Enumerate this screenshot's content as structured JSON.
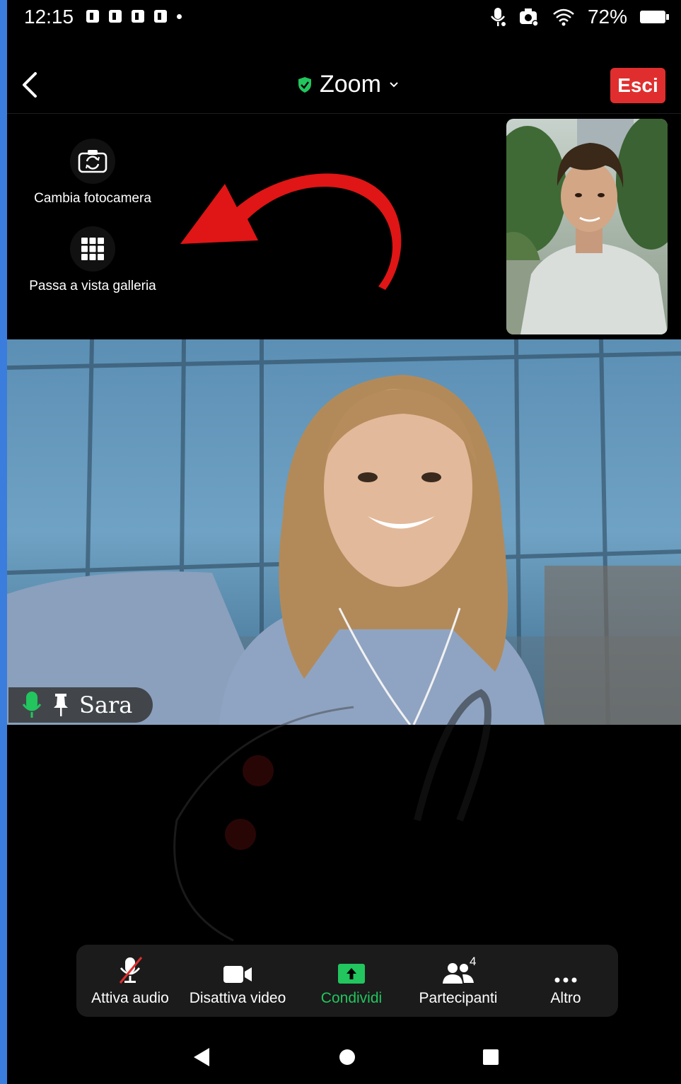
{
  "status_bar": {
    "time": "12:15",
    "battery": "72%",
    "icons": [
      "gallery-notification-icon",
      "facebook-notification-icon",
      "facebook-notification-icon",
      "facebook-notification-icon",
      "dot-icon",
      "mic-in-use-icon",
      "camera-in-use-icon",
      "wifi-icon",
      "battery-icon"
    ]
  },
  "header": {
    "title": "Zoom",
    "leave_label": "Esci",
    "accent_green": "#22c55e",
    "leave_color": "#e02e2e"
  },
  "quick_actions": {
    "switch_camera": "Cambia fotocamera",
    "gallery_view": "Passa a vista galleria"
  },
  "speaker": {
    "name": "Sara"
  },
  "toolbar": {
    "unmute": "Attiva audio",
    "stop_video": "Disattiva video",
    "share": "Condividi",
    "participants": "Partecipanti",
    "participant_count": "4",
    "more": "Altro"
  }
}
